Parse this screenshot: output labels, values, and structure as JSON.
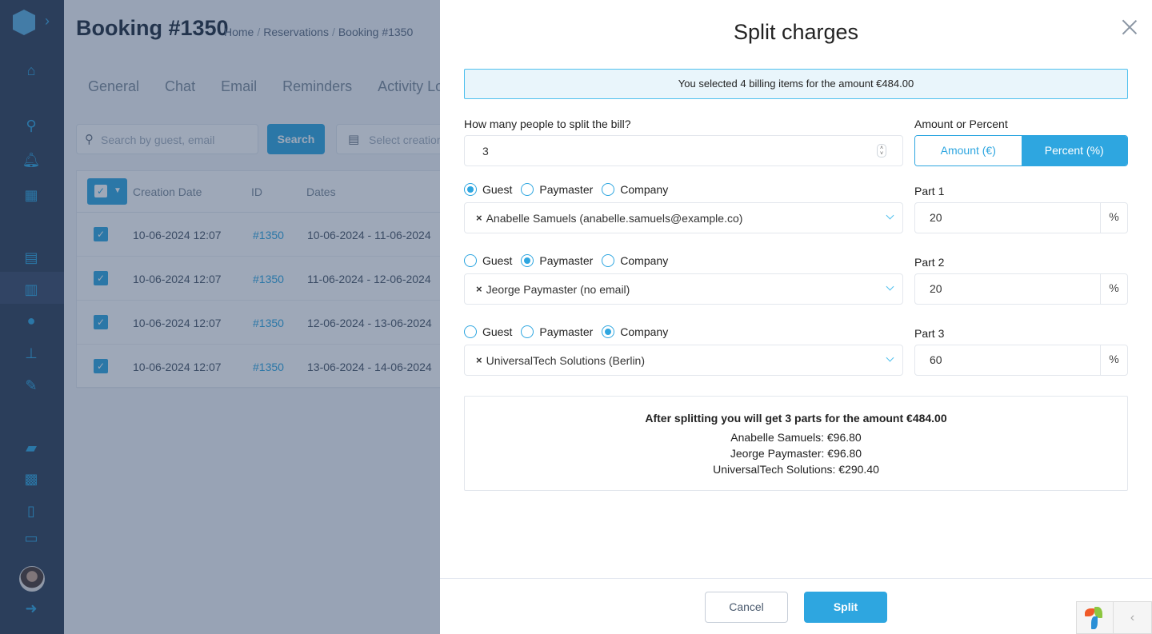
{
  "background": {
    "page_title": "Booking #1350",
    "breadcrumb": [
      "Home",
      "Reservations",
      "Booking #1350"
    ],
    "tabs": [
      "General",
      "Chat",
      "Email",
      "Reminders",
      "Activity Log"
    ],
    "search": {
      "placeholder": "Search by guest, email",
      "button": "Search"
    },
    "date_filter": {
      "placeholder": "Select creation date"
    },
    "table": {
      "headers": {
        "creation_date": "Creation Date",
        "id": "ID",
        "dates": "Dates"
      },
      "rows": [
        {
          "created": "10-06-2024 12:07",
          "id": "#1350",
          "dates": "10-06-2024 - 11-06-2024",
          "checked": true
        },
        {
          "created": "10-06-2024 12:07",
          "id": "#1350",
          "dates": "11-06-2024 - 12-06-2024",
          "checked": true
        },
        {
          "created": "10-06-2024 12:07",
          "id": "#1350",
          "dates": "12-06-2024 - 13-06-2024",
          "checked": true
        },
        {
          "created": "10-06-2024 12:07",
          "id": "#1350",
          "dates": "13-06-2024 - 14-06-2024",
          "checked": true
        }
      ]
    },
    "sidebar_icons": [
      "home-icon",
      "search-icon",
      "bell-icon",
      "dashboard-icon",
      "calendar-icon",
      "document-icon",
      "user-icon",
      "housekeeping-icon",
      "wrench-icon",
      "folder-icon",
      "widgets-icon",
      "book-icon",
      "inbox-icon",
      "avatar",
      "logout-icon"
    ]
  },
  "modal": {
    "title": "Split charges",
    "info": "You selected 4 billing items for the amount €484.00",
    "people_label": "How many people to split the bill?",
    "people_count": "3",
    "mode_label": "Amount or Percent",
    "mode_options": {
      "amount": "Amount (€)",
      "percent": "Percent (%)"
    },
    "mode_selected": "percent",
    "radio_options": [
      "Guest",
      "Paymaster",
      "Company"
    ],
    "parts": [
      {
        "type_selected": "Guest",
        "selection": "Anabelle Samuels (anabelle.samuels@example.co)",
        "label": "Part 1",
        "value": "20",
        "suffix": "%"
      },
      {
        "type_selected": "Paymaster",
        "selection": "Jeorge Paymaster (no email)",
        "label": "Part 2",
        "value": "20",
        "suffix": "%"
      },
      {
        "type_selected": "Company",
        "selection": "UniversalTech Solutions (Berlin)",
        "label": "Part 3",
        "value": "60",
        "suffix": "%"
      }
    ],
    "summary": {
      "heading": "After splitting you will get 3 parts for the amount €484.00",
      "lines": [
        "Anabelle Samuels: €96.80",
        "Jeorge Paymaster: €96.80",
        "UniversalTech Solutions: €290.40"
      ]
    },
    "buttons": {
      "cancel": "Cancel",
      "split": "Split"
    }
  },
  "colors": {
    "accent": "#2ea6e0",
    "info_bg": "#e9f5fb",
    "overlay": "rgba(40,62,98,0.45)"
  }
}
